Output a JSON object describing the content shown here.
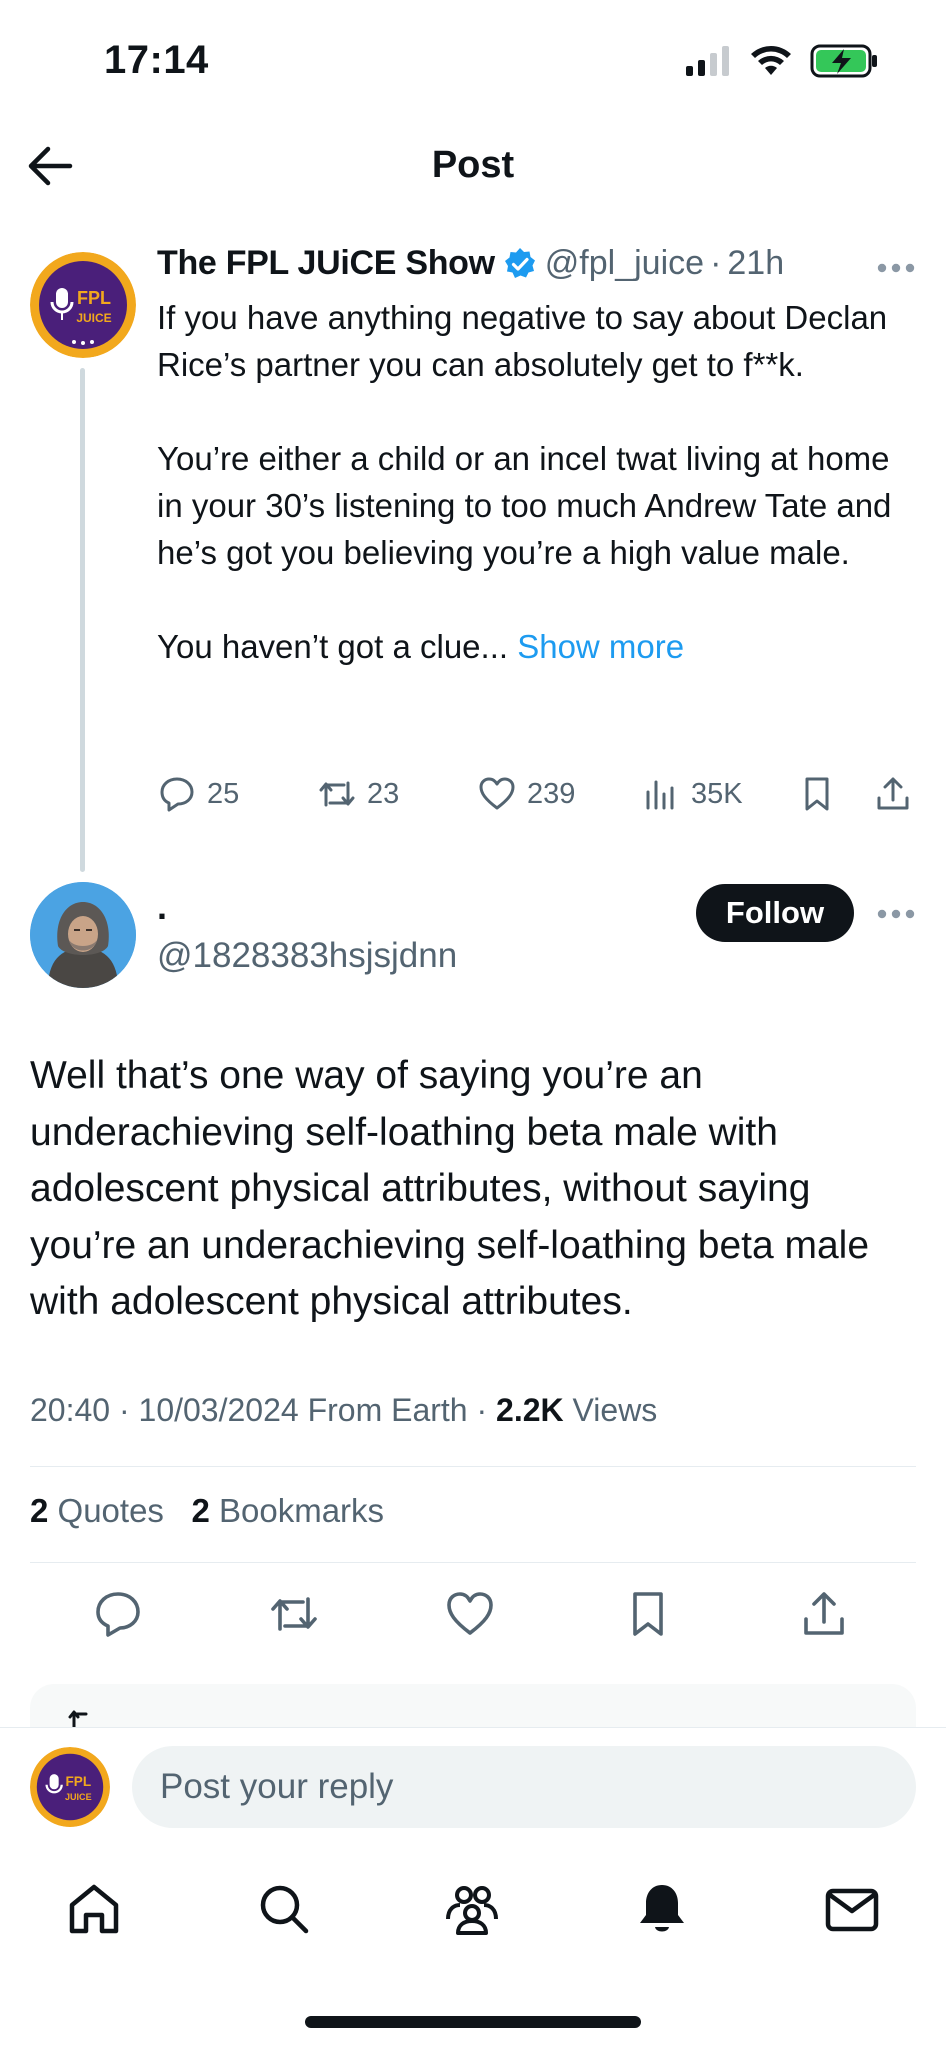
{
  "status_bar": {
    "time": "17:14",
    "icons": [
      "cellular-signal-icon",
      "wifi-icon",
      "battery-charging-icon"
    ]
  },
  "nav": {
    "title": "Post",
    "back_icon": "arrow-left-icon"
  },
  "original_post": {
    "author_name": "The FPL JUiCE Show",
    "verified": true,
    "handle": "@fpl_juice",
    "separator": "·",
    "age": "21h",
    "avatar_text_top": "FPL",
    "avatar_text_bottom": "JUICE",
    "paragraphs": [
      "If you have anything negative to say about Declan Rice’s partner you can absolutely get to f**k.",
      "You’re either a child or an incel twat living at home in your 30’s listening to too much Andrew Tate and he’s got you believing you’re a high value male."
    ],
    "last_line": "You haven’t got a clue...",
    "show_more": "Show more",
    "stats": {
      "replies": "25",
      "reposts": "23",
      "likes": "239",
      "views": "35K"
    }
  },
  "reply_post": {
    "display_name": ".",
    "handle": "@1828383hsjsjdnn",
    "follow_label": "Follow",
    "text": "Well that’s one way of saying you’re an underachieving self-loathing beta male with adolescent physical attributes, without saying you’re an underachieving self-loathing beta male with adolescent physical attributes.",
    "time": "20:40",
    "date": "10/03/2024",
    "source": "From Earth",
    "separator": "·",
    "views_count": "2.2K",
    "views_label": "Views",
    "quotes_count": "2",
    "quotes_label": "Quotes",
    "bookmarks_count": "2",
    "bookmarks_label": "Bookmarks"
  },
  "composer": {
    "placeholder": "Post your reply"
  },
  "tab_bar": [
    "home-icon",
    "search-icon",
    "communities-icon",
    "notifications-icon",
    "messages-icon"
  ],
  "colors": {
    "accent": "#1d9bf0",
    "text": "#0f1419",
    "muted": "#536471",
    "avatar_purple": "#4a1f7a",
    "avatar_gold": "#f2a81d"
  }
}
